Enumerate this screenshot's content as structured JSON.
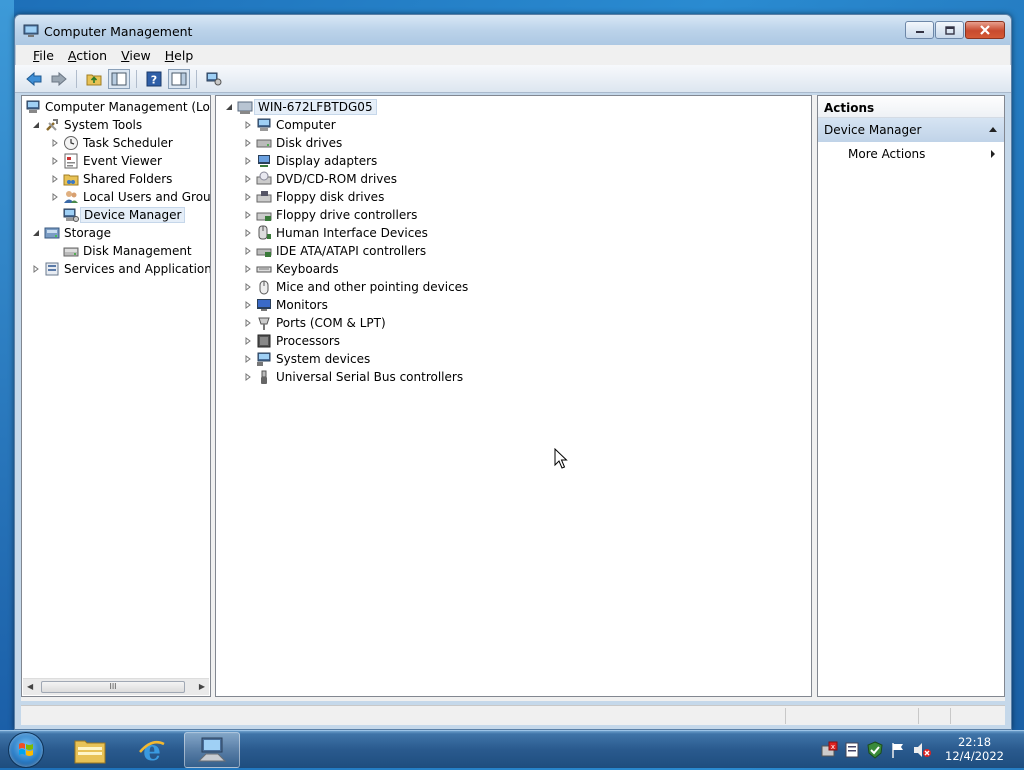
{
  "window": {
    "title": "Computer Management"
  },
  "menu": {
    "file": "File",
    "file_key": "F",
    "file_rest": "ile",
    "action_key": "A",
    "action_rest": "ction",
    "view_key": "V",
    "view_rest": "iew",
    "help_key": "H",
    "help_rest": "elp"
  },
  "toolbar": {
    "icons": [
      "back-icon",
      "forward-icon",
      "up-folder-icon",
      "show-hide-console-tree-icon",
      "help-icon",
      "show-hide-action-pane-icon",
      "device-manager-icon"
    ]
  },
  "nav_tree": {
    "root": "Computer Management (Local",
    "items": [
      {
        "label": "System Tools",
        "icon": "tools-icon"
      },
      {
        "label": "Task Scheduler",
        "icon": "clock-icon"
      },
      {
        "label": "Event Viewer",
        "icon": "event-viewer-icon"
      },
      {
        "label": "Shared Folders",
        "icon": "shared-folder-icon"
      },
      {
        "label": "Local Users and Groups",
        "icon": "users-icon"
      },
      {
        "label": "Device Manager",
        "icon": "device-manager-icon"
      },
      {
        "label": "Storage",
        "icon": "storage-icon"
      },
      {
        "label": "Disk Management",
        "icon": "disk-management-icon"
      },
      {
        "label": "Services and Applications",
        "icon": "services-icon"
      }
    ],
    "selected": "Device Manager",
    "scroll_thumb": "III"
  },
  "devices": {
    "root": "WIN-672LFBTDG05",
    "categories": [
      {
        "label": "Computer",
        "icon": "computer-icon"
      },
      {
        "label": "Disk drives",
        "icon": "disk-drive-icon"
      },
      {
        "label": "Display adapters",
        "icon": "display-adapter-icon"
      },
      {
        "label": "DVD/CD-ROM drives",
        "icon": "dvd-icon"
      },
      {
        "label": "Floppy disk drives",
        "icon": "floppy-icon"
      },
      {
        "label": "Floppy drive controllers",
        "icon": "floppy-controller-icon"
      },
      {
        "label": "Human Interface Devices",
        "icon": "hid-icon"
      },
      {
        "label": "IDE ATA/ATAPI controllers",
        "icon": "ide-icon"
      },
      {
        "label": "Keyboards",
        "icon": "keyboard-icon"
      },
      {
        "label": "Mice and other pointing devices",
        "icon": "mouse-icon"
      },
      {
        "label": "Monitors",
        "icon": "monitor-icon"
      },
      {
        "label": "Ports (COM & LPT)",
        "icon": "port-icon"
      },
      {
        "label": "Processors",
        "icon": "processor-icon"
      },
      {
        "label": "System devices",
        "icon": "system-device-icon"
      },
      {
        "label": "Universal Serial Bus controllers",
        "icon": "usb-icon"
      }
    ]
  },
  "actions": {
    "header": "Actions",
    "section": "Device Manager",
    "more": "More Actions"
  },
  "taskbar": {
    "pinned": [
      "windows-explorer-icon",
      "internet-explorer-icon",
      "computer-management-icon"
    ],
    "tray_icons": [
      "action-center-icon",
      "notes-icon",
      "security-icon",
      "flag-icon",
      "volume-muted-icon"
    ],
    "time": "22:18",
    "date": "12/4/2022"
  }
}
